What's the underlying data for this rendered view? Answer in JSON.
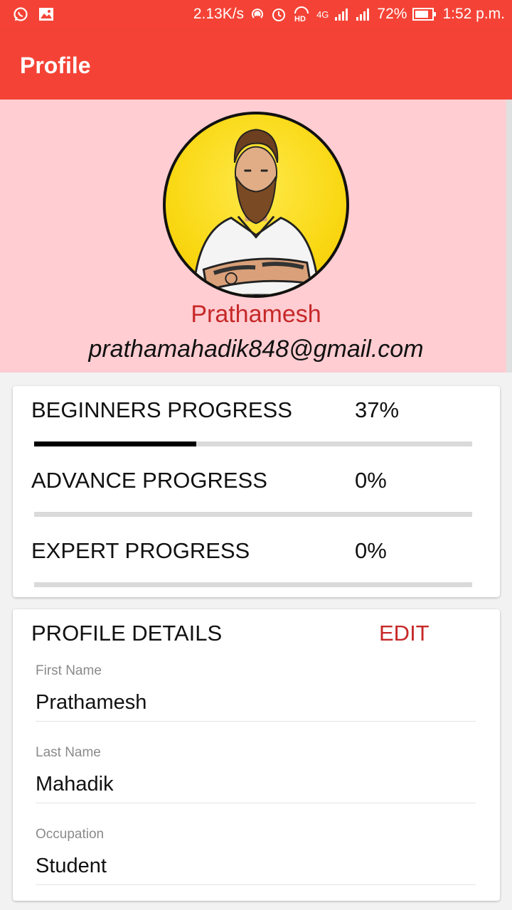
{
  "status_bar": {
    "net_speed": "2.13K/s",
    "network": "4G",
    "battery": "72%",
    "time": "1:52 p.m.",
    "icons": [
      "whatsapp-icon",
      "gallery-icon",
      "hotspot-icon",
      "alarm-icon",
      "hd-icon",
      "signal-icon",
      "battery-icon"
    ]
  },
  "appbar": {
    "title": "Profile",
    "color": "#f44336"
  },
  "profile": {
    "name": "Prathamesh",
    "email": "prathamahadik848@gmail.com",
    "header_color": "#ffcdd2",
    "name_color": "#c62828"
  },
  "progress": [
    {
      "label": "BEGINNERS PROGRESS",
      "value": "37%",
      "fraction": 0.37
    },
    {
      "label": "ADVANCE PROGRESS",
      "value": "0%",
      "fraction": 0
    },
    {
      "label": "EXPERT PROGRESS",
      "value": "0%",
      "fraction": 0
    }
  ],
  "details": {
    "title": "PROFILE DETAILS",
    "edit_label": "EDIT",
    "fields": [
      {
        "label": "First Name",
        "value": "Prathamesh"
      },
      {
        "label": "Last Name",
        "value": "Mahadik"
      },
      {
        "label": "Occupation",
        "value": "Student"
      }
    ]
  }
}
